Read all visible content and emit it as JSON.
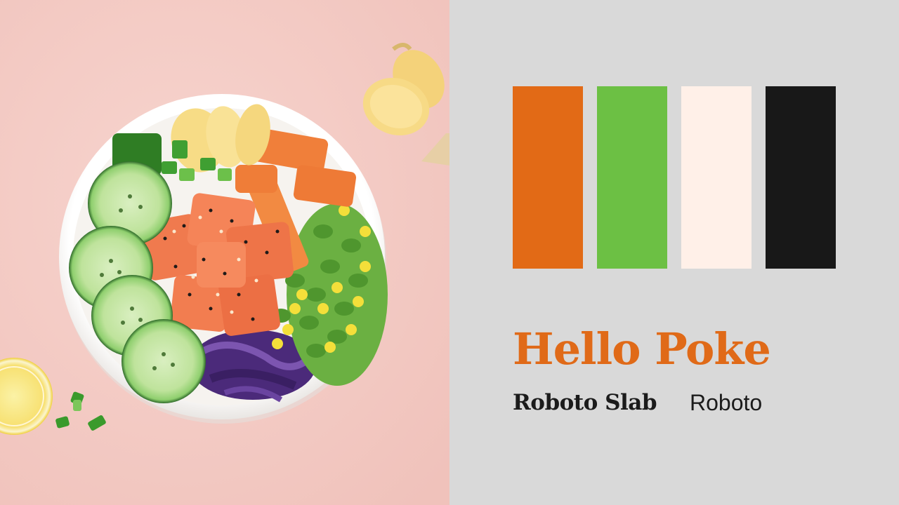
{
  "brand": {
    "name": "Hello Poke",
    "name_color": "#e06a18"
  },
  "palette": {
    "swatches": [
      {
        "name": "orange",
        "color": "#e26a16"
      },
      {
        "name": "green",
        "color": "#6cc044"
      },
      {
        "name": "cream",
        "color": "#fff0e8"
      },
      {
        "name": "black",
        "color": "#181818"
      }
    ]
  },
  "typography": {
    "heading_font_label": "Roboto Slab",
    "body_font_label": "Roboto"
  },
  "photo": {
    "subject_icon": "poke-bowl-photo",
    "background_color": "#f5cdc7"
  }
}
